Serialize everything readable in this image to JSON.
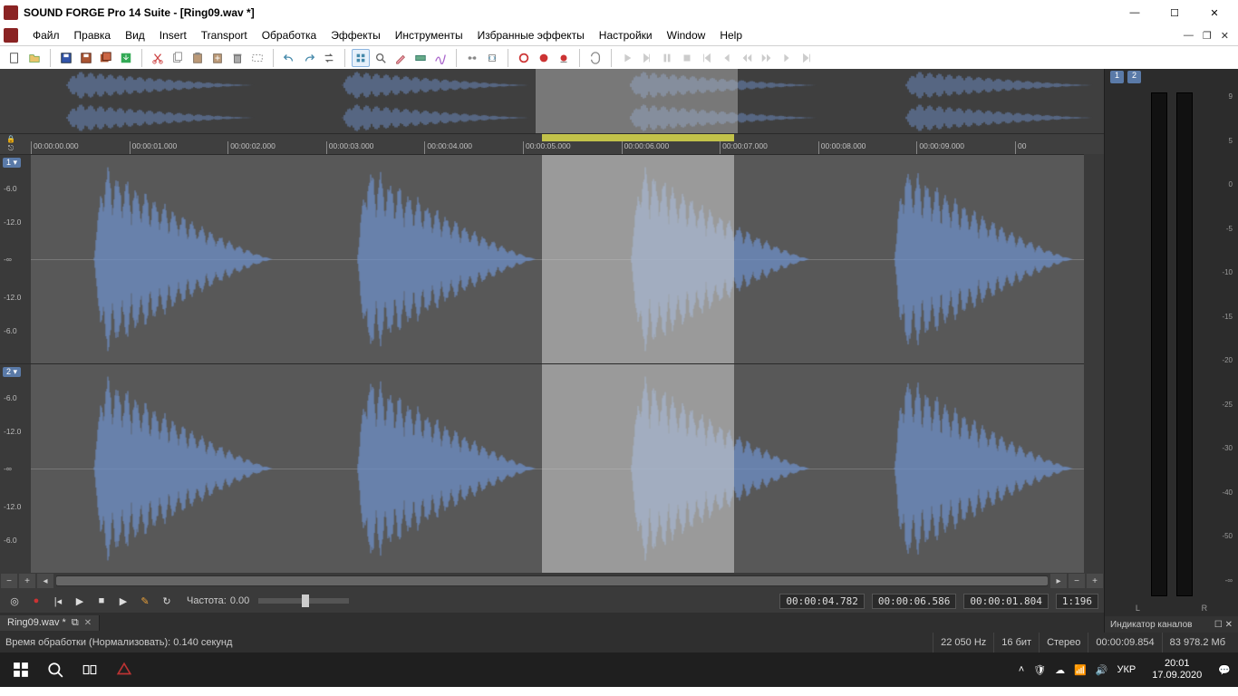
{
  "titlebar": {
    "title": "SOUND FORGE Pro 14 Suite - [Ring09.wav *]"
  },
  "menu": {
    "items": [
      "Файл",
      "Правка",
      "Вид",
      "Insert",
      "Transport",
      "Обработка",
      "Эффекты",
      "Инструменты",
      "Избранные эффекты",
      "Настройки",
      "Window",
      "Help"
    ]
  },
  "mdi": {
    "min": "—",
    "restore": "❐",
    "close": "✕"
  },
  "win": {
    "min": "—",
    "max": "☐",
    "close": "✕"
  },
  "timeline": {
    "ticks": [
      "00:00:00.000",
      "00:00:01.000",
      "00:00:02.000",
      "00:00:03.000",
      "00:00:04.000",
      "00:00:05.000",
      "00:00:06.000",
      "00:00:07.000",
      "00:00:08.000",
      "00:00:09.000",
      "00"
    ],
    "selection_start_frac": 0.485,
    "selection_end_frac": 0.668
  },
  "channels": {
    "ch1": {
      "badge": "1 ▾",
      "db_labels": [
        "-6.0",
        "-12.0",
        "-∞",
        "-12.0",
        "-6.0"
      ]
    },
    "ch2": {
      "badge": "2 ▾",
      "db_labels": [
        "-6.0",
        "-12.0",
        "-∞",
        "-12.0",
        "-6.0"
      ]
    }
  },
  "transport": {
    "rate_label": "Частота:",
    "rate_value": "0.00",
    "sel_start": "00:00:04.782",
    "sel_end": "00:00:06.586",
    "sel_len": "00:00:01.804",
    "zoom": "1:196"
  },
  "doc_tab": {
    "label": "Ring09.wav *",
    "pin": "⧉",
    "close": "✕"
  },
  "meters": {
    "ch_tabs": [
      "1",
      "2"
    ],
    "scale": [
      "9",
      "5",
      "0",
      "-5",
      "-10",
      "-15",
      "-20",
      "-25",
      "-30",
      "-40",
      "-50",
      "-∞"
    ],
    "L": "L",
    "R": "R",
    "panel_title": "Индикатор каналов",
    "panel_pin": "☐",
    "panel_close": "✕"
  },
  "status": {
    "processing": "Время обработки (Нормализовать): 0.140 секунд",
    "sample_rate": "22 050 Hz",
    "bit_depth": "16 бит",
    "channels": "Стерео",
    "length": "00:00:09.854",
    "filesize": "83 978.2 Мб"
  },
  "taskbar": {
    "lang": "УКР",
    "time": "20:01",
    "date": "17.09.2020"
  },
  "colors": {
    "wave": "#6f8fc7",
    "wave_dark": "#4a6aa4",
    "bg_track": "#585858",
    "selection": "#d3d3d3"
  }
}
